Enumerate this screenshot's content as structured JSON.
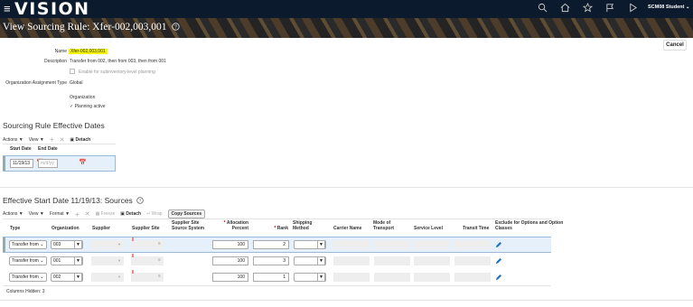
{
  "header": {
    "menu_icon": "hamburger-icon",
    "brand": "VISION",
    "icons": [
      "search-icon",
      "home-icon",
      "star-icon",
      "flag-icon",
      "play-icon"
    ],
    "user": "SCM08 Student"
  },
  "page": {
    "title": "View Sourcing Rule: Xfer-002,003,001",
    "help_icon": "help-icon",
    "cancel": "Cancel"
  },
  "form": {
    "name_label": "Name",
    "name_value": "Xfer-002,003,001",
    "description_label": "Description",
    "description_value": "Transfer from 002, then from 003, then from 001",
    "subinv_label": "Enable for subinventory-level planning",
    "org_assign_label": "Organization Assignment Type",
    "org_assign_value": "Global",
    "organization_label": "Organization",
    "planning_active": "Planning active"
  },
  "dates_section": {
    "title": "Sourcing Rule Effective Dates",
    "actions": "Actions",
    "view": "View",
    "detach": "Detach",
    "col_start": "Start Date",
    "col_end": "End Date",
    "start_value": "11/19/13",
    "end_placeholder": "m/d/yy"
  },
  "sources_section": {
    "title": "Effective Start Date 11/19/13: Sources",
    "actions": "Actions",
    "view": "View",
    "format": "Format",
    "freeze": "Freeze",
    "detach": "Detach",
    "wrap": "Wrap",
    "copy_sources": "Copy Sources",
    "columns": {
      "type": "Type",
      "organization": "Organization",
      "supplier": "Supplier",
      "supplier_site": "Supplier Site",
      "supplier_site_source": "Supplier Site Source System",
      "allocation": "Allocation Percent",
      "rank": "Rank",
      "shipping": "Shipping Method",
      "carrier": "Carrier Name",
      "mode": "Mode of Transport",
      "service": "Service Level",
      "transit": "Transit Time",
      "exclude": "Exclude for Options and Option Classes"
    },
    "rows": [
      {
        "type": "Transfer from",
        "org": "003",
        "allocation": "100",
        "rank": "2"
      },
      {
        "type": "Transfer from",
        "org": "001",
        "allocation": "100",
        "rank": "3"
      },
      {
        "type": "Transfer from",
        "org": "002",
        "allocation": "100",
        "rank": "1"
      }
    ],
    "columns_hidden": "Columns Hidden: 3"
  }
}
